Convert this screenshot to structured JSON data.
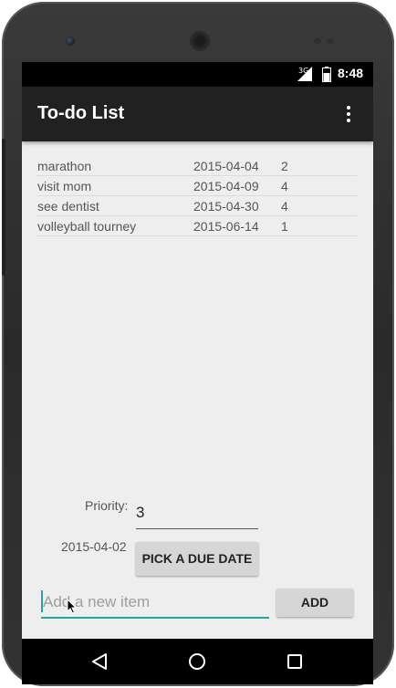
{
  "status_bar": {
    "network": "3G",
    "time": "8:48",
    "icons": [
      "signal-icon",
      "battery-icon"
    ]
  },
  "app_bar": {
    "title": "To-do List",
    "menu_icon": "overflow-menu-icon"
  },
  "todo_list": [
    {
      "name": "marathon",
      "date": "2015-04-04",
      "priority": "2"
    },
    {
      "name": "visit mom",
      "date": "2015-04-09",
      "priority": "4"
    },
    {
      "name": "see dentist",
      "date": "2015-04-30",
      "priority": "4"
    },
    {
      "name": "volleyball tourney",
      "date": "2015-06-14",
      "priority": "1"
    }
  ],
  "form": {
    "priority_label": "Priority:",
    "priority_value": "3",
    "due_date": "2015-04-02",
    "pick_date_button": "PICK A DUE DATE",
    "new_item_placeholder": "Add a new item",
    "new_item_value": "",
    "add_button": "ADD"
  },
  "nav_bar": {
    "icons": [
      "back-icon",
      "home-icon",
      "recent-apps-icon"
    ]
  },
  "colors": {
    "app_bar": "#212121",
    "accent": "#26a69a",
    "background": "#eeeeee",
    "button": "#d6d6d6"
  }
}
